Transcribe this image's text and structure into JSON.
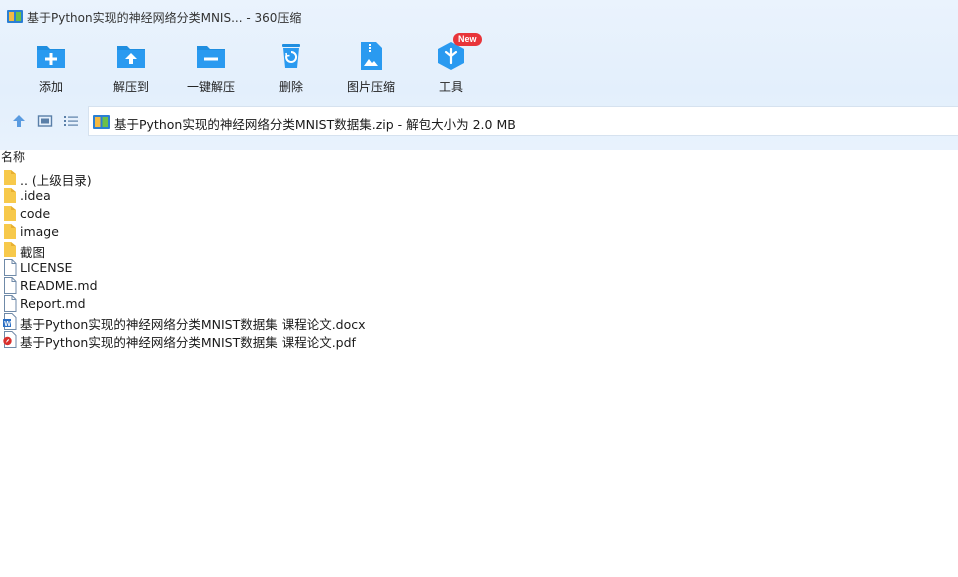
{
  "window": {
    "title": "基于Python实现的神经网络分类MNIS... - 360压缩"
  },
  "toolbar": {
    "items": [
      {
        "label": "添加",
        "icon": "add-folder-icon"
      },
      {
        "label": "解压到",
        "icon": "extract-to-icon"
      },
      {
        "label": "一键解压",
        "icon": "one-click-extract-icon"
      },
      {
        "label": "删除",
        "icon": "delete-bin-icon"
      },
      {
        "label": "图片压缩",
        "icon": "image-compress-icon"
      },
      {
        "label": "工具",
        "icon": "tools-cube-icon"
      }
    ],
    "badge": "New"
  },
  "navbar": {
    "path": "基于Python实现的神经网络分类MNIST数据集.zip - 解包大小为 2.0 MB"
  },
  "list": {
    "column_name": "名称",
    "rows": [
      {
        "name": ".. (上级目录)",
        "type": "folder"
      },
      {
        "name": ".idea",
        "type": "folder"
      },
      {
        "name": "code",
        "type": "folder"
      },
      {
        "name": "image",
        "type": "folder"
      },
      {
        "name": "截图",
        "type": "folder"
      },
      {
        "name": "LICENSE",
        "type": "file"
      },
      {
        "name": "README.md",
        "type": "file"
      },
      {
        "name": "Report.md",
        "type": "file"
      },
      {
        "name": "基于Python实现的神经网络分类MNIST数据集 课程论文.docx",
        "type": "docx"
      },
      {
        "name": "基于Python实现的神经网络分类MNIST数据集 课程论文.pdf",
        "type": "pdf"
      }
    ]
  },
  "colors": {
    "accent": "#1f8ee0",
    "header_bg": "#e6f0fc",
    "folder": "#f7c94b",
    "badge": "#e8353a"
  }
}
